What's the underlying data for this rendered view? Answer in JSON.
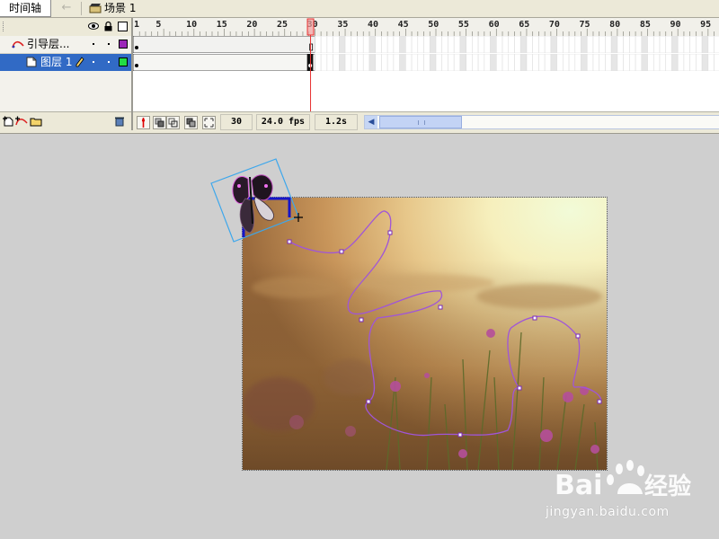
{
  "topbar": {
    "timeline_tab": "时间轴",
    "scene_label": "场景 1"
  },
  "layers": [
    {
      "name": "引导层...",
      "color": "#9b28b8"
    },
    {
      "name": "图层 1",
      "color": "#22dd44",
      "selected": true
    }
  ],
  "ruler": {
    "labels": [
      "1",
      "5",
      "10",
      "15",
      "20",
      "25",
      "30",
      "35",
      "40",
      "45",
      "50",
      "55",
      "60",
      "65",
      "70",
      "75",
      "80",
      "85",
      "90",
      "95"
    ],
    "current_frame": 30
  },
  "status": {
    "current_frame": "30",
    "fps": "24.0 fps",
    "elapsed": "1.2s"
  },
  "watermark": {
    "logo": "Bai du 经验",
    "url": "jingyan.baidu.com"
  },
  "colors": {
    "selection": "#316ac5",
    "playhead": "#e83030",
    "guide_path": "#a055d8",
    "bounding_box": "#3da7ec"
  }
}
